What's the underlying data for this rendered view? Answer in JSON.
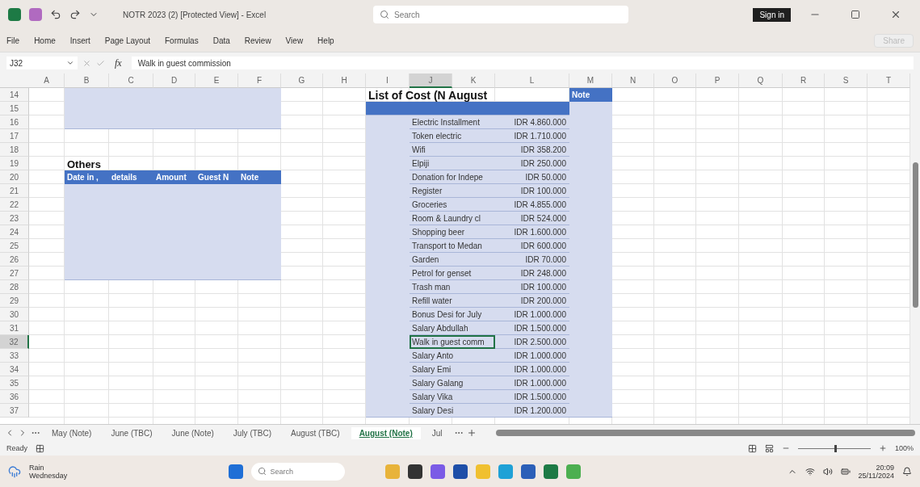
{
  "window": {
    "title": "NOTR 2023 (2) [Protected View] - Excel",
    "search_placeholder": "Search",
    "sign_in": "Sign in",
    "share": "Share"
  },
  "menu": [
    "File",
    "Home",
    "Insert",
    "Page Layout",
    "Formulas",
    "Data",
    "Review",
    "View",
    "Help"
  ],
  "formula_bar": {
    "name_box": "J32",
    "fx": "fx",
    "value": "Walk in guest commission"
  },
  "sheet": {
    "columns": [
      {
        "label": "A",
        "selected": false
      },
      {
        "label": "B",
        "selected": false
      },
      {
        "label": "C",
        "selected": false
      },
      {
        "label": "D",
        "selected": false
      },
      {
        "label": "E",
        "selected": false
      },
      {
        "label": "F",
        "selected": false
      },
      {
        "label": "G",
        "selected": false
      },
      {
        "label": "H",
        "selected": false
      },
      {
        "label": "I",
        "selected": false
      },
      {
        "label": "J",
        "selected": true
      },
      {
        "label": "K",
        "selected": false
      },
      {
        "label": "L",
        "selected": false
      },
      {
        "label": "M",
        "selected": false
      },
      {
        "label": "N",
        "selected": false
      },
      {
        "label": "O",
        "selected": false
      },
      {
        "label": "P",
        "selected": false
      },
      {
        "label": "Q",
        "selected": false
      },
      {
        "label": "R",
        "selected": false
      },
      {
        "label": "S",
        "selected": false
      },
      {
        "label": "T",
        "selected": false
      }
    ],
    "rows": [
      {
        "number": "14",
        "selected": false
      },
      {
        "number": "15",
        "selected": false
      },
      {
        "number": "16",
        "selected": false
      },
      {
        "number": "17",
        "selected": false
      },
      {
        "number": "18",
        "selected": false
      },
      {
        "number": "19",
        "selected": false
      },
      {
        "number": "20",
        "selected": false
      },
      {
        "number": "21",
        "selected": false
      },
      {
        "number": "22",
        "selected": false
      },
      {
        "number": "23",
        "selected": false
      },
      {
        "number": "24",
        "selected": false
      },
      {
        "number": "25",
        "selected": false
      },
      {
        "number": "26",
        "selected": false
      },
      {
        "number": "27",
        "selected": false
      },
      {
        "number": "28",
        "selected": false
      },
      {
        "number": "29",
        "selected": false
      },
      {
        "number": "30",
        "selected": false
      },
      {
        "number": "31",
        "selected": false
      },
      {
        "number": "32",
        "selected": true
      },
      {
        "number": "33",
        "selected": false
      },
      {
        "number": "34",
        "selected": false
      },
      {
        "number": "35",
        "selected": false
      },
      {
        "number": "36",
        "selected": false
      },
      {
        "number": "37",
        "selected": false
      }
    ],
    "others": {
      "title": "Others",
      "headers": [
        "Date in ,",
        "details",
        "Amount",
        "Guest N",
        "Note"
      ]
    },
    "cost_list": {
      "title": "List of Cost (N August",
      "note_header": "Note",
      "items": [
        {
          "name": "Electric Installment",
          "amount": "IDR 4.860.000",
          "selected": false
        },
        {
          "name": "Token electric",
          "amount": "IDR 1.710.000",
          "selected": false
        },
        {
          "name": "Wifi",
          "amount": "IDR 358.200",
          "selected": false
        },
        {
          "name": "Elpiji",
          "amount": "IDR 250.000",
          "selected": false
        },
        {
          "name": "Donation for Indepe",
          "amount": "IDR 50.000",
          "selected": false
        },
        {
          "name": "Register",
          "amount": "IDR 100.000",
          "selected": false
        },
        {
          "name": "Groceries",
          "amount": "IDR 4.855.000",
          "selected": false
        },
        {
          "name": "Room & Laundry cl",
          "amount": "IDR 524.000",
          "selected": false
        },
        {
          "name": "Shopping beer",
          "amount": "IDR 1.600.000",
          "selected": false
        },
        {
          "name": "Transport to Medan",
          "amount": "IDR 600.000",
          "selected": false
        },
        {
          "name": "Garden",
          "amount": "IDR 70.000",
          "selected": false
        },
        {
          "name": "Petrol for genset",
          "amount": "IDR 248.000",
          "selected": false
        },
        {
          "name": "Trash man",
          "amount": "IDR 100.000",
          "selected": false
        },
        {
          "name": "Refill water",
          "amount": "IDR 200.000",
          "selected": false
        },
        {
          "name": "Bonus Desi for July",
          "amount": "IDR 1.000.000",
          "selected": false
        },
        {
          "name": "Salary Abdullah",
          "amount": "IDR 1.500.000",
          "selected": false
        },
        {
          "name": "Walk in guest comm",
          "amount": "IDR 2.500.000",
          "selected": true
        },
        {
          "name": "Salary Anto",
          "amount": "IDR 1.000.000",
          "selected": false
        },
        {
          "name": "Salary Emi",
          "amount": "IDR 1.000.000",
          "selected": false
        },
        {
          "name": "Salary Galang",
          "amount": "IDR 1.000.000",
          "selected": false
        },
        {
          "name": "Salary Vika",
          "amount": "IDR 1.500.000",
          "selected": false
        },
        {
          "name": "Salary Desi",
          "amount": "IDR 1.200.000",
          "selected": false
        }
      ]
    }
  },
  "sheet_tabs": [
    {
      "label": "May (Note)",
      "selected": false
    },
    {
      "label": "June (TBC)",
      "selected": false
    },
    {
      "label": "June (Note)",
      "selected": false
    },
    {
      "label": "July (TBC)",
      "selected": false
    },
    {
      "label": "August (TBC)",
      "selected": false
    },
    {
      "label": "August (Note)",
      "selected": true
    },
    {
      "label": "Jul",
      "selected": false
    }
  ],
  "status_bar": {
    "mode": "Ready",
    "zoom_slider": {
      "level": 0.5
    },
    "zoom": "100%"
  },
  "taskbar": {
    "weather": "Rain",
    "day": "Wednesday",
    "search_placeholder": "Search",
    "time": "20:09",
    "date": "25/11/2024"
  }
}
